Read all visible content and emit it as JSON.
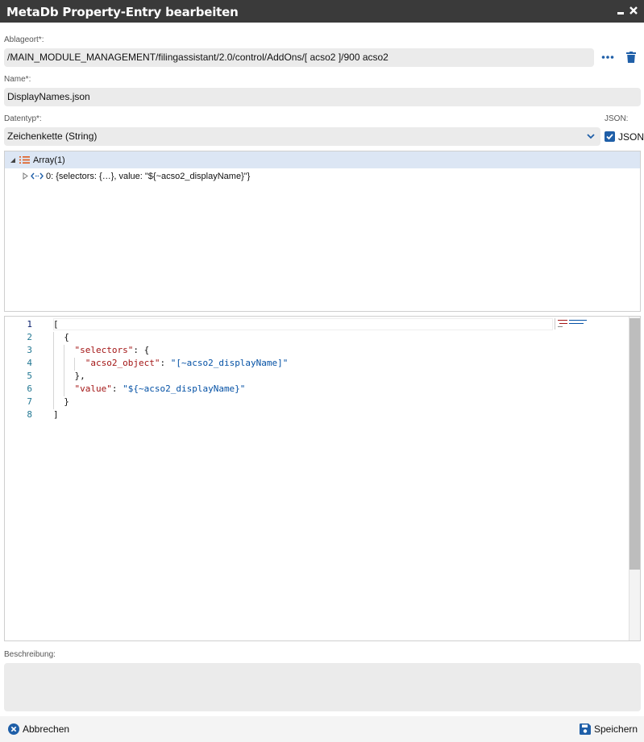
{
  "window": {
    "title": "MetaDb Property-Entry bearbeiten",
    "minimize_glyph": "▬",
    "close_glyph": "✕"
  },
  "ablageort": {
    "label": "Ablageort*:",
    "value": "/MAIN_MODULE_MANAGEMENT/filingassistant/2.0/control/AddOns/[ acso2 ]/900 acso2"
  },
  "name": {
    "label": "Name*:",
    "value": "DisplayNames.json"
  },
  "datentyp": {
    "label": "Datentyp*:",
    "value": "Zeichenkette (String)"
  },
  "json": {
    "label": "JSON:",
    "checkbox_label": "JSON",
    "checked": true
  },
  "tree": {
    "root_label": "Array(1)",
    "child_label": "0: {selectors: {…}, value: \"${~acso2_displayName}\"}"
  },
  "editor": {
    "line_numbers": [
      "1",
      "2",
      "3",
      "4",
      "5",
      "6",
      "7",
      "8"
    ],
    "lines": [
      "[",
      "  {",
      "    \"selectors\": {",
      "      \"acso2_object\": \"[~acso2_displayName]\"",
      "    },",
      "    \"value\": \"${~acso2_displayName}\"",
      "  }",
      "]"
    ]
  },
  "beschreibung": {
    "label": "Beschreibung:",
    "value": ""
  },
  "footer": {
    "cancel_label": "Abbrechen",
    "save_label": "Speichern"
  },
  "colors": {
    "accent": "#1f5fa8",
    "titlebar": "#3a3a3a",
    "json_key": "#a31515",
    "json_string": "#0451a5"
  }
}
